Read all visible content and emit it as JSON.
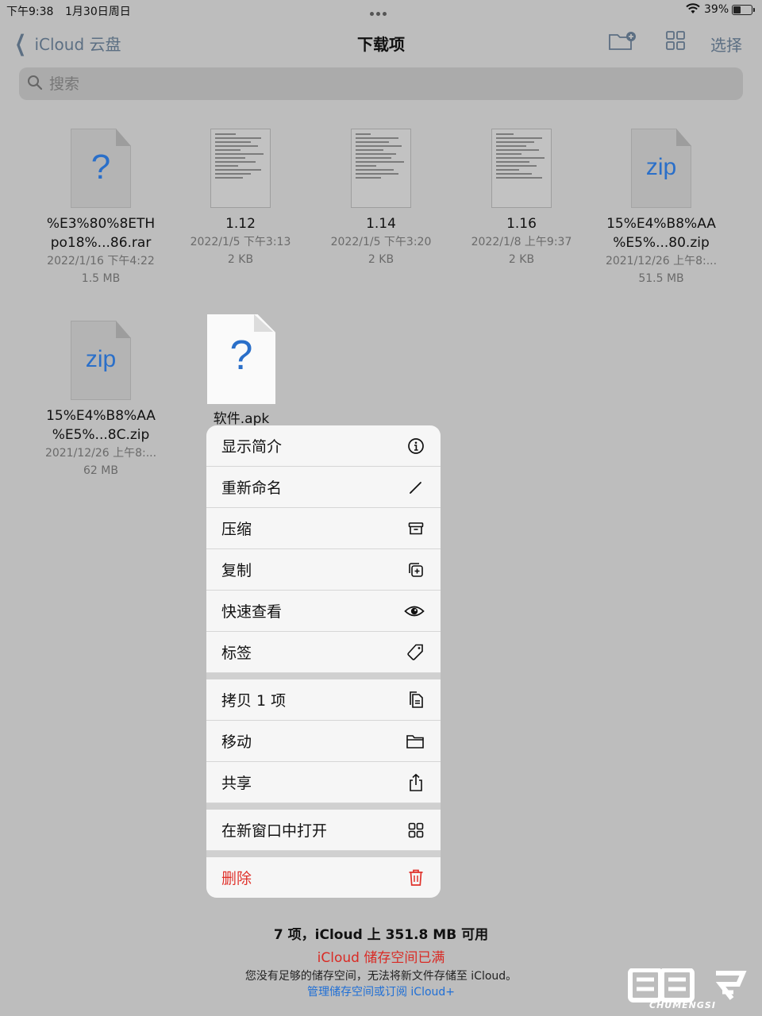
{
  "status": {
    "time": "下午9:38",
    "date": "1月30日周日",
    "battery": "39%"
  },
  "nav": {
    "back_label": "iCloud 云盘",
    "title": "下载项",
    "select_label": "选择"
  },
  "search": {
    "placeholder": "搜索"
  },
  "files": [
    {
      "name_line1": "%E3%80%8ETH",
      "name_line2": "po18%...86.rar",
      "date": "2022/1/16 下午4:22",
      "size": "1.5 MB",
      "icon": "question-doc"
    },
    {
      "name_line1": "1.12",
      "name_line2": "",
      "date": "2022/1/5 下午3:13",
      "size": "2 KB",
      "icon": "text-doc"
    },
    {
      "name_line1": "1.14",
      "name_line2": "",
      "date": "2022/1/5 下午3:20",
      "size": "2 KB",
      "icon": "text-doc"
    },
    {
      "name_line1": "1.16",
      "name_line2": "",
      "date": "2022/1/8 上午9:37",
      "size": "2 KB",
      "icon": "text-doc"
    },
    {
      "name_line1": "15%E4%B8%AA",
      "name_line2": "%E5%...80.zip",
      "date": "2021/12/26 上午8:...",
      "size": "51.5 MB",
      "icon": "zip-doc",
      "glyph": "zip"
    },
    {
      "name_line1": "15%E4%B8%AA",
      "name_line2": "%E5%...8C.zip",
      "date": "2021/12/26 上午8:...",
      "size": "62 MB",
      "icon": "zip-doc",
      "glyph": "zip"
    }
  ],
  "selected_file": {
    "name": "软件.apk",
    "glyph": "?"
  },
  "question_glyph": "?",
  "menu": {
    "groups": [
      [
        {
          "label": "显示简介",
          "icon": "info-icon"
        },
        {
          "label": "重新命名",
          "icon": "pencil-icon"
        },
        {
          "label": "压缩",
          "icon": "archive-box-icon"
        },
        {
          "label": "复制",
          "icon": "duplicate-icon"
        },
        {
          "label": "快速查看",
          "icon": "eye-icon"
        },
        {
          "label": "标签",
          "icon": "tag-icon"
        }
      ],
      [
        {
          "label": "拷贝 1 项",
          "icon": "copy-docs-icon"
        },
        {
          "label": "移动",
          "icon": "folder-icon"
        },
        {
          "label": "共享",
          "icon": "share-icon"
        }
      ],
      [
        {
          "label": "在新窗口中打开",
          "icon": "grid-window-icon"
        }
      ],
      [
        {
          "label": "删除",
          "icon": "trash-icon",
          "destructive": true
        }
      ]
    ]
  },
  "footer": {
    "count": "7 项，iCloud 上 351.8 MB 可用",
    "warning": "iCloud 储存空间已满",
    "description": "您没有足够的储存空间，无法将新文件存储至 iCloud。",
    "link": "管理储存空间或订阅 iCloud+"
  },
  "watermark": {
    "text": "CHUMENGSI"
  },
  "colors": {
    "accent": "#1f6fd6",
    "destructive": "#e0322b",
    "file_glyph": "#2a6fc9"
  }
}
